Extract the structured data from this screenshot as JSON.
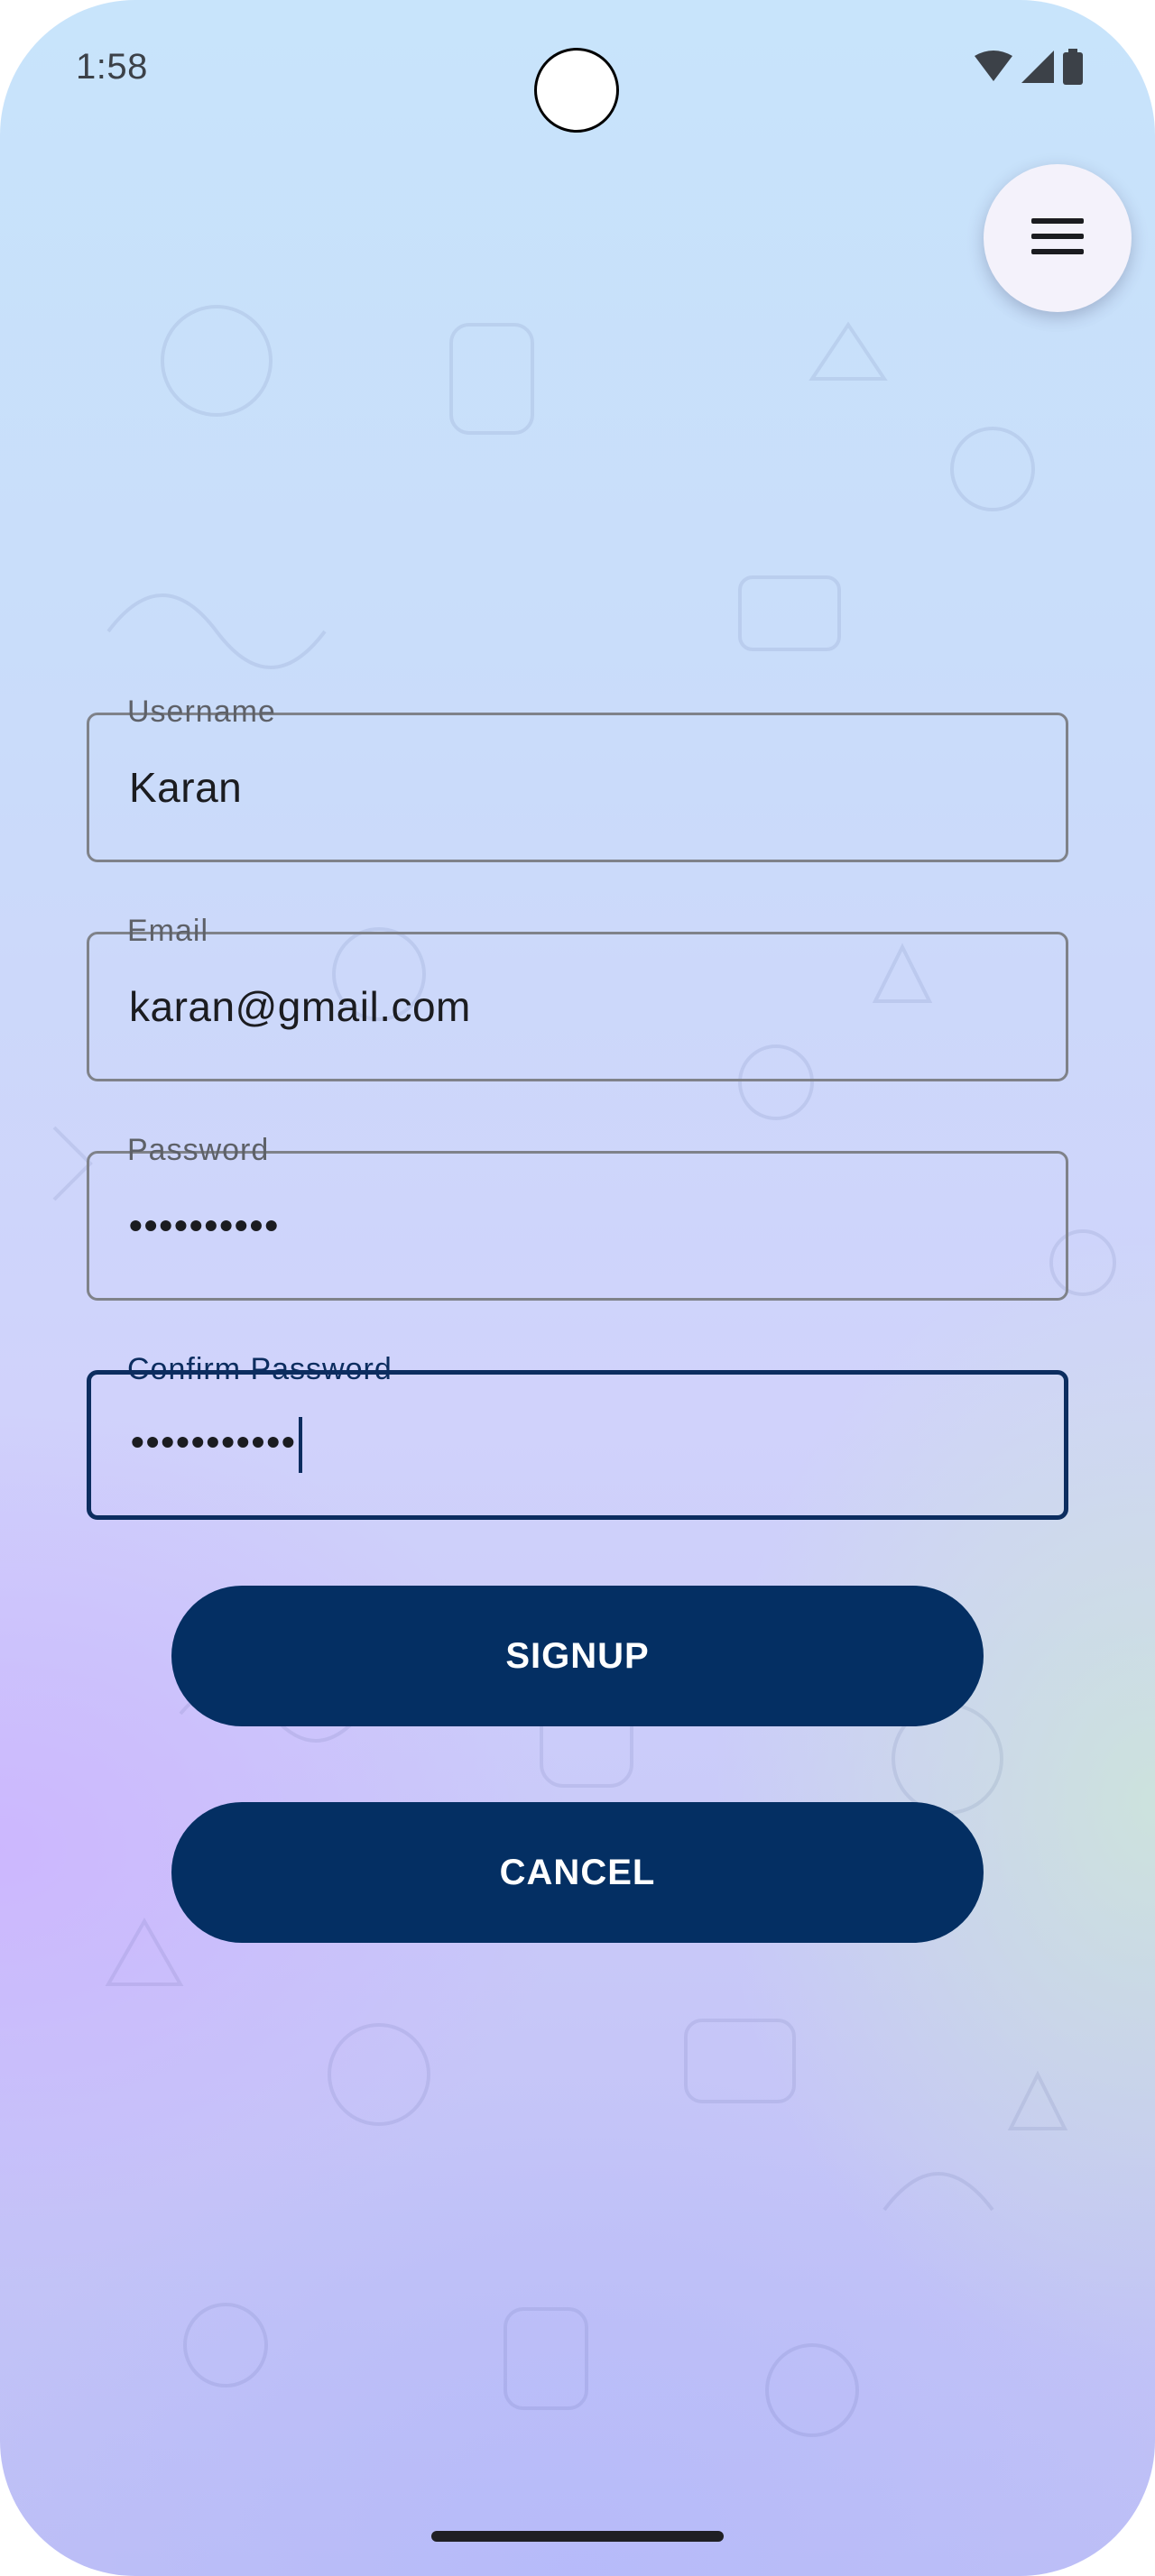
{
  "status_bar": {
    "time": "1:58",
    "icons": [
      "wifi-icon",
      "cellular-signal-icon",
      "battery-icon"
    ]
  },
  "menu": {
    "icon": "hamburger-menu-icon"
  },
  "form": {
    "username": {
      "label": "Username",
      "value": "Karan"
    },
    "email": {
      "label": "Email",
      "value": "karan@gmail.com"
    },
    "password": {
      "label": "Password",
      "value": "••••••••••"
    },
    "confirm_password": {
      "label": "Confirm Password",
      "value": "•••••••••••"
    }
  },
  "buttons": {
    "signup": "SIGNUP",
    "cancel": "CANCEL"
  },
  "colors": {
    "primary": "#042f63",
    "focused_outline": "#0c2d5f",
    "outline": "#7f8289",
    "fab_background": "#f4f2fb"
  }
}
